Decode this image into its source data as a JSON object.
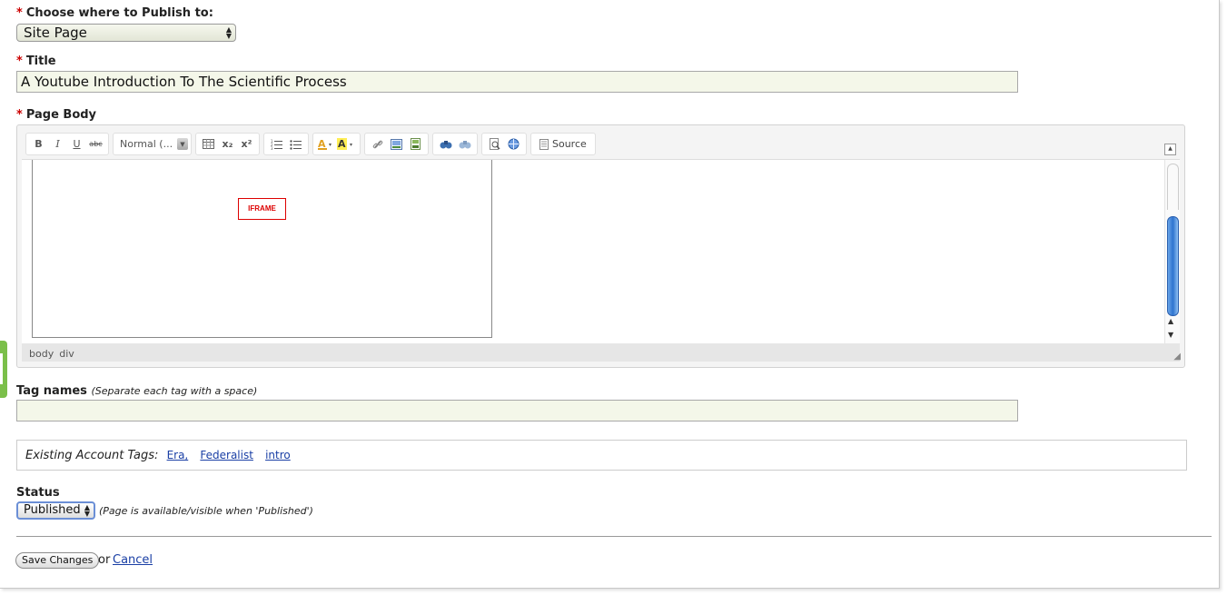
{
  "publish": {
    "label": "Choose where to Publish to:",
    "required": "*",
    "selected": "Site Page"
  },
  "title_field": {
    "label": "Title",
    "required": "*",
    "value": "A Youtube Introduction To The Scientific Process"
  },
  "page_body": {
    "label": "Page Body",
    "required": "*",
    "toolbar": {
      "bold": "B",
      "italic": "I",
      "underline": "U",
      "strike": "abc",
      "format": "Normal (...",
      "subscript": "x₂",
      "superscript": "x²",
      "source": "Source"
    },
    "iframe_placeholder": "IFRAME",
    "path": [
      "body",
      "div"
    ]
  },
  "tags": {
    "label": "Tag names",
    "hint": "(Separate each tag with a space)",
    "value": "",
    "existing_label": "Existing Account Tags:",
    "existing": [
      "Era,",
      "Federalist",
      "intro"
    ]
  },
  "status": {
    "label": "Status",
    "selected": "Published",
    "hint": "(Page is available/visible when 'Published')"
  },
  "actions": {
    "save": "Save Changes",
    "or": "or",
    "cancel": "Cancel"
  },
  "colors": {
    "required": "#cc0000",
    "input_bg": "#f4f7e9",
    "link": "#1a3fa5",
    "iframe_border": "#dd0000",
    "side_tab": "#7bbf4a"
  }
}
